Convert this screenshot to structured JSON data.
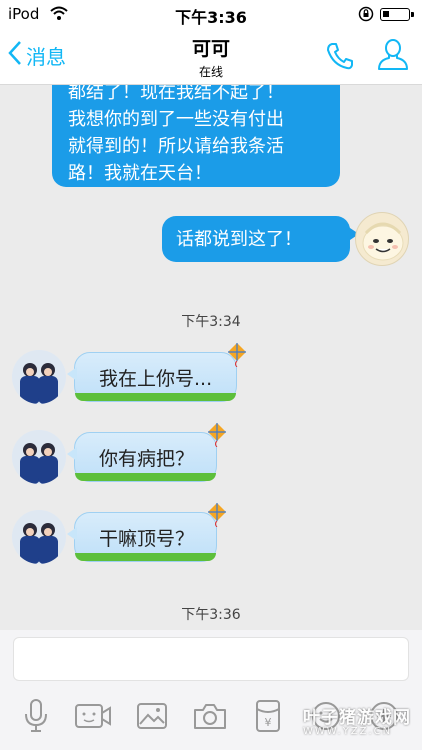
{
  "status_bar": {
    "carrier": "iPod",
    "time": "下午3:36"
  },
  "nav": {
    "back_label": "消息",
    "title": "可可",
    "subtitle": "在线"
  },
  "messages": {
    "m1_lines": [
      "都结了！现在我结不起了！",
      "我想你的到了一些没有付出",
      "就得到的！所以请给我条活",
      "路！我就在天台！"
    ],
    "m2": "话都说到这了！",
    "time1": "下午3:34",
    "m3": "我在上你号...",
    "m4": "你有病把？",
    "m5": "干嘛顶号？",
    "time2": "下午3:36"
  },
  "input": {
    "placeholder": ""
  },
  "toolbar_icons": [
    "microphone-icon",
    "video-icon",
    "image-icon",
    "camera-icon",
    "red-packet-icon",
    "emoji-icon",
    "plus-icon"
  ],
  "watermark": {
    "big": "叶子猪游戏网",
    "small": "WWW.YZZ.CN"
  },
  "colors": {
    "accent": "#12b7f5",
    "bubble_blue": "#1b9ce8",
    "background": "#ebebeb"
  }
}
